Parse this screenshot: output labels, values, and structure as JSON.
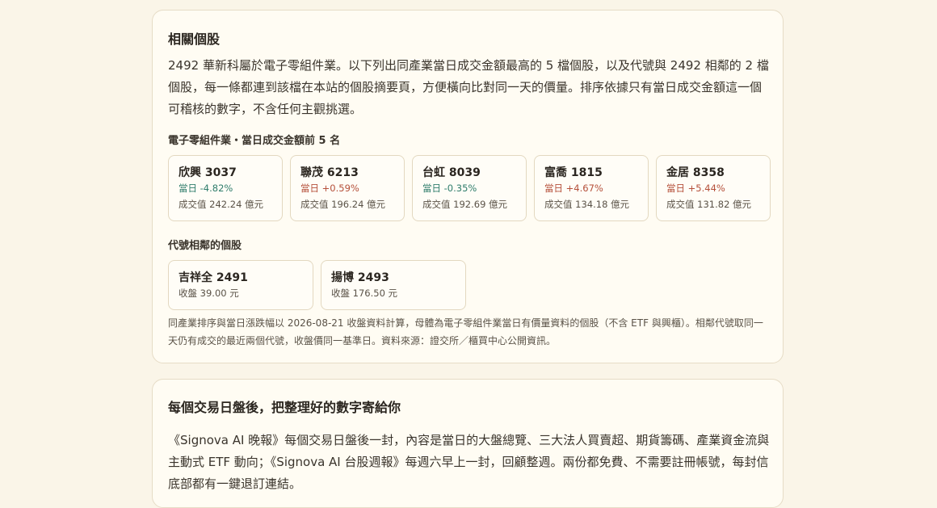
{
  "related": {
    "title": "相關個股",
    "intro": "2492 華新科屬於電子零組件業。以下列出同產業當日成交金額最高的 5 檔個股，以及代號與 2492 相鄰的 2 檔個股，每一條都連到該檔在本站的個股摘要頁，方便橫向比對同一天的價量。排序依據只有當日成交金額這一個可稽核的數字，不含任何主觀挑選。",
    "top_heading": "電子零組件業・當日成交金額前 5 名",
    "top_stocks": [
      {
        "name": "欣興 3037",
        "change_label": "當日",
        "change": "-4.82%",
        "direction": "down",
        "value_label": "成交值",
        "value": "242.24 億元"
      },
      {
        "name": "聯茂 6213",
        "change_label": "當日",
        "change": "+0.59%",
        "direction": "up",
        "value_label": "成交值",
        "value": "196.24 億元"
      },
      {
        "name": "台虹 8039",
        "change_label": "當日",
        "change": "-0.35%",
        "direction": "down",
        "value_label": "成交值",
        "value": "192.69 億元"
      },
      {
        "name": "富喬 1815",
        "change_label": "當日",
        "change": "+4.67%",
        "direction": "up",
        "value_label": "成交值",
        "value": "134.18 億元"
      },
      {
        "name": "金居 8358",
        "change_label": "當日",
        "change": "+5.44%",
        "direction": "up",
        "value_label": "成交值",
        "value": "131.82 億元"
      }
    ],
    "near_heading": "代號相鄰的個股",
    "near_stocks": [
      {
        "name": "吉祥全 2491",
        "close_label": "收盤",
        "close": "39.00 元"
      },
      {
        "name": "揚博 2493",
        "close_label": "收盤",
        "close": "176.50 元"
      }
    ],
    "footnote": "同產業排序與當日漲跌幅以 2026-08-21 收盤資料計算，母體為電子零組件業當日有價量資料的個股（不含 ETF 與興櫃）。相鄰代號取同一天仍有成交的最近兩個代號，收盤價同一基準日。資料來源：證交所／櫃買中心公開資訊。"
  },
  "newsletter": {
    "title": "每個交易日盤後，把整理好的數字寄給你",
    "body": "《Signova AI 晚報》每個交易日盤後一封，內容是當日的大盤總覽、三大法人買賣超、期貨籌碼、產業資金流與主動式 ETF 動向；《Signova AI 台股週報》每週六早上一封，回顧整週。兩份都免費、不需要註冊帳號，每封信底部都有一鍵退訂連結。"
  },
  "colors": {
    "down": "#2f7d6b",
    "up": "#b5503a",
    "card_border": "#e6dcc6",
    "page_bg": "#faf5e8"
  }
}
